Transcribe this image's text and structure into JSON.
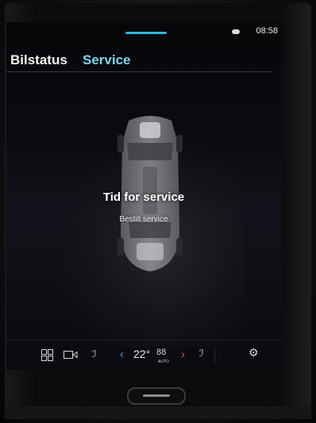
{
  "status_bar": {
    "time": "08:58",
    "connectivity_icon": "cloud-icon",
    "accent_color": "#2fb6d8"
  },
  "tabs": [
    {
      "label": "Bilstatus",
      "active": false
    },
    {
      "label": "Service",
      "active": true
    }
  ],
  "service": {
    "title": "Tid for service",
    "link": "Bestill service"
  },
  "climate_bar": {
    "temperature": "22°",
    "fan": "88",
    "mode": "AUTO",
    "icons": [
      "home-grid-icon",
      "camera-icon",
      "seat-heat-left-icon",
      "arrow-left-icon",
      "arrow-right-icon",
      "seat-heat-right-icon",
      "gear-icon"
    ],
    "left_arrow_color": "#3aa5e8",
    "right_arrow_color": "#e84a52"
  }
}
